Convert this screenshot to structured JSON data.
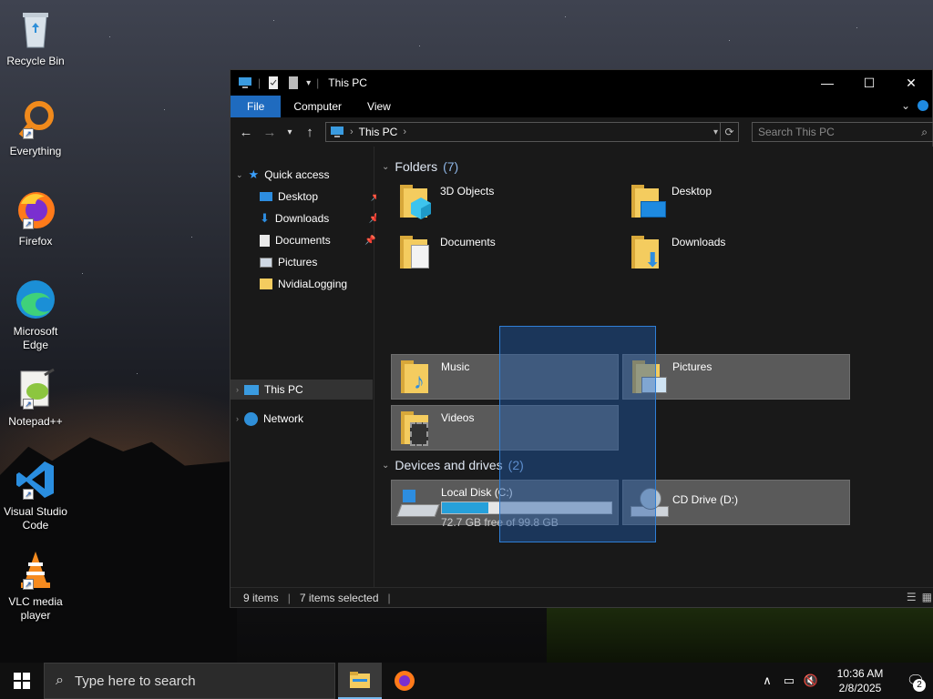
{
  "desktop": {
    "icons": [
      {
        "label": "Recycle Bin",
        "icon": "recycle-bin-icon"
      },
      {
        "label": "Everything",
        "icon": "everything-search-icon"
      },
      {
        "label": "Firefox",
        "icon": "firefox-icon"
      },
      {
        "label": "Microsoft Edge",
        "icon": "edge-icon"
      },
      {
        "label": "Notepad++",
        "icon": "notepad-plus-plus-icon"
      },
      {
        "label": "Visual Studio Code",
        "icon": "vscode-icon"
      },
      {
        "label": "VLC media player",
        "icon": "vlc-icon"
      }
    ]
  },
  "window": {
    "title": "This PC",
    "controls": {
      "minimize": "—",
      "maximize": "☐",
      "close": "✕"
    },
    "ribbon_tabs": [
      "File",
      "Computer",
      "View"
    ],
    "address": {
      "path": "This PC"
    },
    "search": {
      "placeholder": "Search This PC"
    },
    "nav_pane": {
      "quick_access": "Quick access",
      "items": [
        {
          "label": "Desktop",
          "pinned": true
        },
        {
          "label": "Downloads",
          "pinned": true
        },
        {
          "label": "Documents",
          "pinned": true
        },
        {
          "label": "Pictures",
          "pinned": true
        },
        {
          "label": "NvidiaLogging",
          "pinned": false
        }
      ],
      "this_pc": "This PC",
      "network": "Network"
    },
    "folders_group": {
      "title": "Folders",
      "count": "(7)"
    },
    "folders": [
      {
        "label": "3D Objects",
        "selected": false
      },
      {
        "label": "Desktop",
        "selected": false
      },
      {
        "label": "Documents",
        "selected": false
      },
      {
        "label": "Downloads",
        "selected": false
      },
      {
        "label": "Music",
        "selected": true
      },
      {
        "label": "Pictures",
        "selected": true
      },
      {
        "label": "Videos",
        "selected": true
      }
    ],
    "drives_group": {
      "title": "Devices and drives",
      "count": "(2)"
    },
    "drives": [
      {
        "label": "Local Disk (C:)",
        "free_text": "72.7 GB free of 99.8 GB",
        "used_fraction": 0.272
      },
      {
        "label": "CD Drive (D:)"
      }
    ],
    "status": {
      "items": "9 items",
      "selected": "7 items selected"
    }
  },
  "taskbar": {
    "search_placeholder": "Type here to search",
    "time": "10:36 AM",
    "date": "2/8/2025",
    "notifications": "2"
  }
}
